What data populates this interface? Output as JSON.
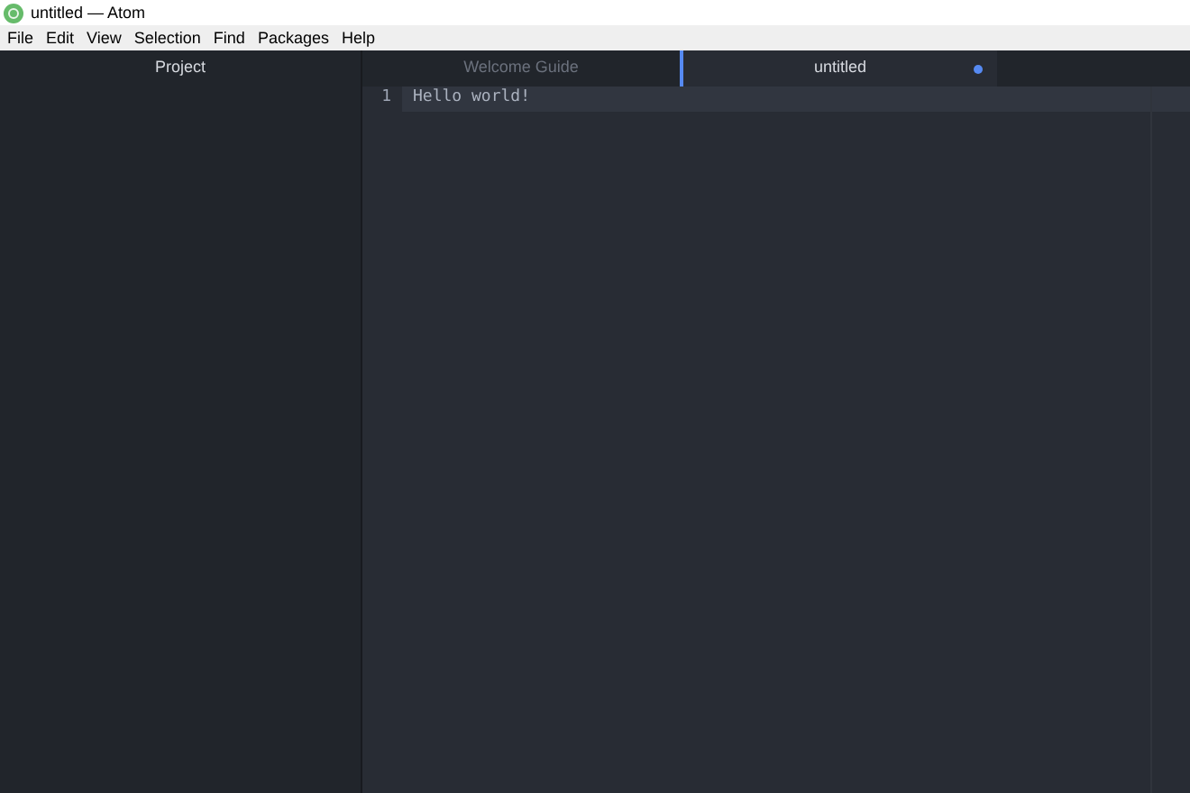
{
  "window": {
    "title": "untitled — Atom"
  },
  "menu": [
    "File",
    "Edit",
    "View",
    "Selection",
    "Find",
    "Packages",
    "Help"
  ],
  "sidebar": {
    "title": "Project"
  },
  "tabs": [
    {
      "label": "Welcome Guide",
      "selected": false,
      "modified": false
    },
    {
      "label": "untitled",
      "selected": true,
      "modified": true
    }
  ],
  "editor": {
    "lines": [
      {
        "number": "1",
        "text": "Hello world!",
        "current": true
      }
    ]
  }
}
